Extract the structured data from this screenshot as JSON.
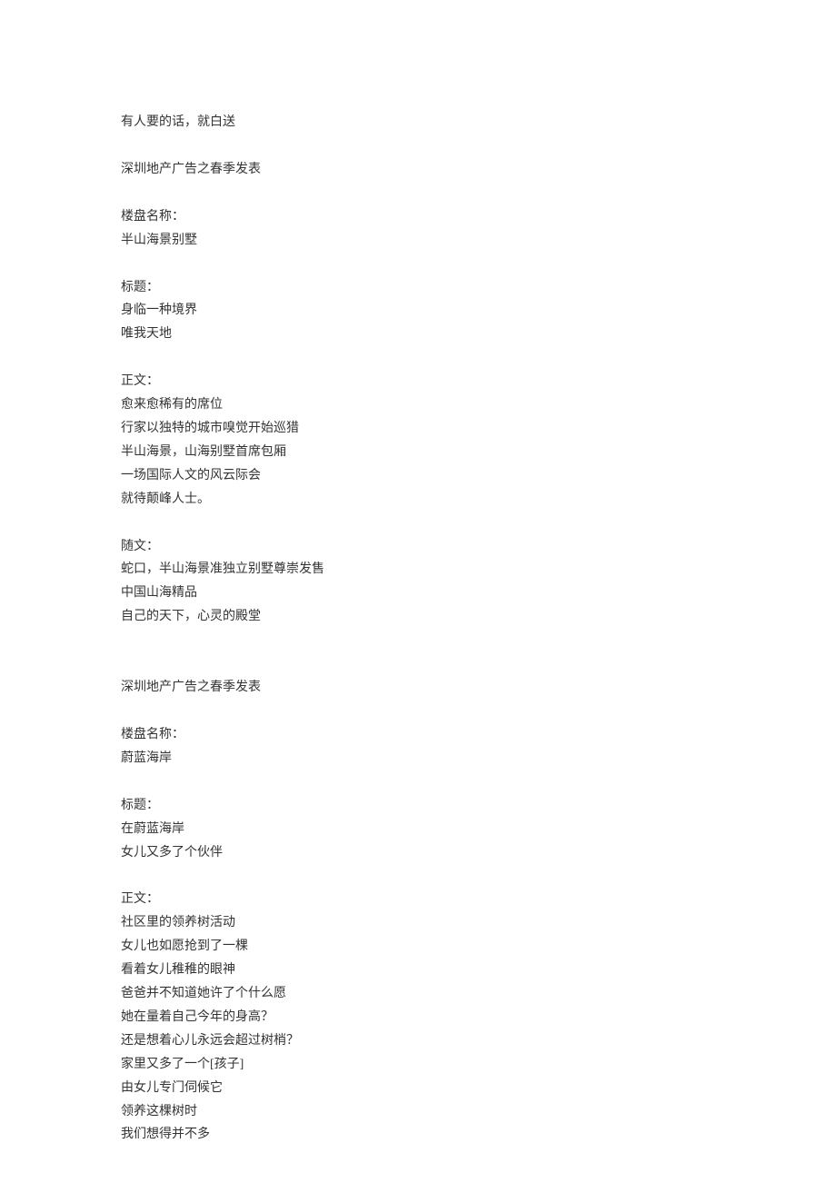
{
  "intro_line": "有人要的话，就白送",
  "ad1": {
    "header": "深圳地产广告之春季发表",
    "name_label": "楼盘名称：",
    "name_value": "半山海景别墅",
    "title_label": "标题：",
    "title_line1": "身临一种境界",
    "title_line2": "唯我天地",
    "body_label": "正文：",
    "body_line1": "愈来愈稀有的席位",
    "body_line2": "行家以独特的城市嗅觉开始巡猎",
    "body_line3": "半山海景，山海别墅首席包厢",
    "body_line4": "一场国际人文的风云际会",
    "body_line5": "就待颠峰人士。",
    "follow_label": "随文：",
    "follow_line1": "蛇口，半山海景准独立别墅尊崇发售",
    "follow_line2": "中国山海精品",
    "follow_line3": "自己的天下，心灵的殿堂"
  },
  "ad2": {
    "header": "深圳地产广告之春季发表",
    "name_label": "楼盘名称：",
    "name_value": "蔚蓝海岸",
    "title_label": "标题：",
    "title_line1": "在蔚蓝海岸",
    "title_line2": "女儿又多了个伙伴",
    "body_label": "正文：",
    "body_line1": "社区里的领养树活动",
    "body_line2": "女儿也如愿抢到了一棵",
    "body_line3": "看着女儿稚稚的眼神",
    "body_line4": "爸爸并不知道她许了个什么愿",
    "body_line5": "她在量着自己今年的身高？",
    "body_line6": "还是想着心儿永远会超过树梢？",
    "body_line7": "家里又多了一个[孩子]",
    "body_line8": "由女儿专门伺候它",
    "body_line9": "领养这棵树时",
    "body_line10": "我们想得并不多"
  }
}
